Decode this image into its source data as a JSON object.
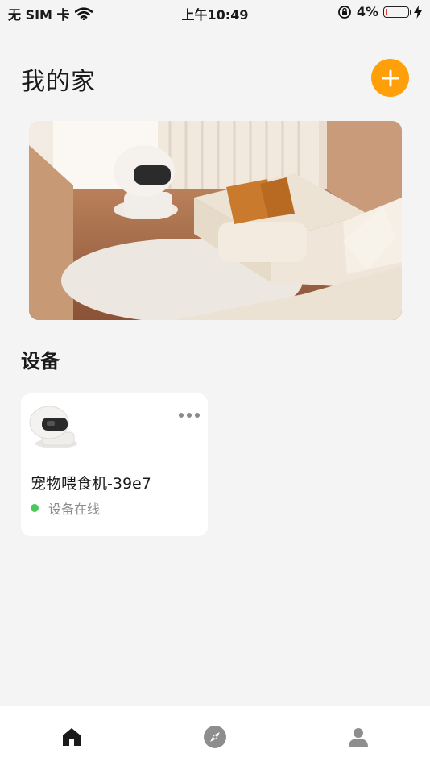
{
  "status_bar": {
    "carrier": "无 SIM 卡",
    "time": "上午10:49",
    "battery_percent": "4%",
    "battery_level": 0.04
  },
  "header": {
    "title": "我的家"
  },
  "devices_section": {
    "title": "设备",
    "items": [
      {
        "name": "宠物喂食机-39e7",
        "status": "设备在线",
        "status_color": "#4cc85a"
      }
    ]
  },
  "tab_bar": {
    "tabs": [
      {
        "icon": "home-icon",
        "active": true
      },
      {
        "icon": "compass-icon",
        "active": false
      },
      {
        "icon": "profile-icon",
        "active": false
      }
    ]
  },
  "colors": {
    "accent": "#ff9f0a",
    "background": "#f4f4f4"
  }
}
